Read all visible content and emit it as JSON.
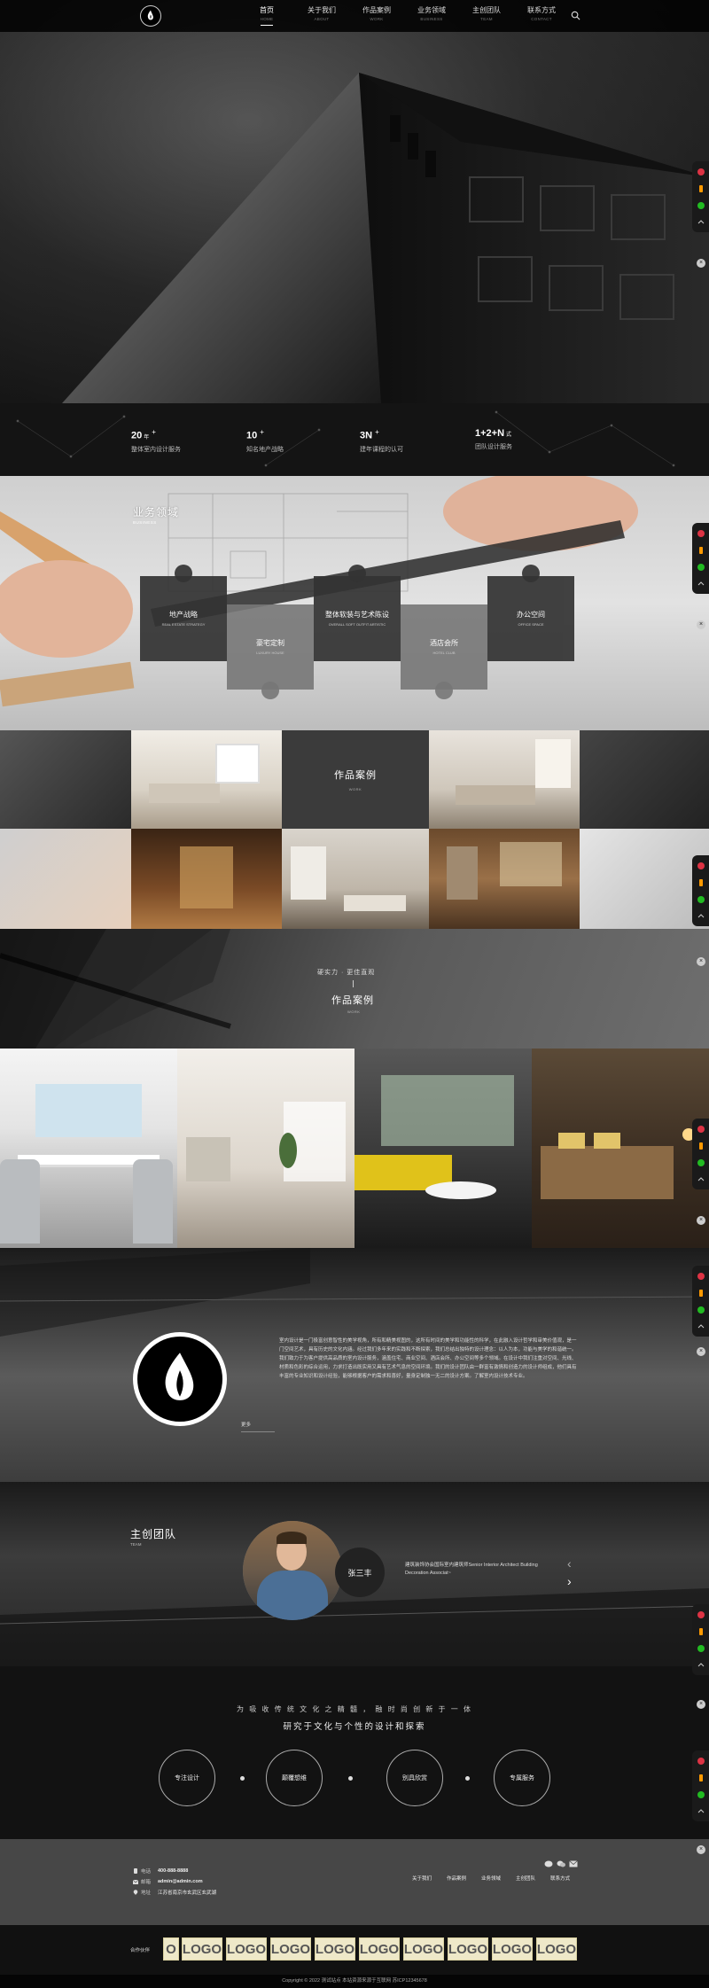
{
  "nav": [
    {
      "cn": "首页",
      "en": "HOME"
    },
    {
      "cn": "关于我们",
      "en": "ABOUT"
    },
    {
      "cn": "作品案例",
      "en": "WORK"
    },
    {
      "cn": "业务领域",
      "en": "BUSINESS"
    },
    {
      "cn": "主创团队",
      "en": "TEAM"
    },
    {
      "cn": "联系方式",
      "en": "CONTACT"
    }
  ],
  "stats": [
    {
      "num": "20",
      "unit": "年",
      "label": "整体室内设计服务"
    },
    {
      "num": "10",
      "unit": "",
      "label": "知名地产战略"
    },
    {
      "num": "3N",
      "unit": "",
      "label": "建年课程的认可"
    },
    {
      "num": "1+2+N",
      "unit": "式",
      "label": "团队设计服务"
    }
  ],
  "business": {
    "title": "业务领域",
    "subtitle": "BUSINESS",
    "items": [
      {
        "cn": "地产战略",
        "en": "REAL ESTATE STRATEGY"
      },
      {
        "cn": "豪宅定制",
        "en": "LUXURY HOUSE"
      },
      {
        "cn": "整体软装与艺术陈设",
        "en": "OVERALL SOFT OUTFIT ARTISTIC"
      },
      {
        "cn": "酒店会所",
        "en": "HOTEL CLUB"
      },
      {
        "cn": "办公空间",
        "en": "OFFICE SPACE"
      }
    ]
  },
  "works": {
    "title": "作品案例",
    "subtitle": "WORK"
  },
  "work2": {
    "slogan": "硬实力 · 更佳直观",
    "title": "作品案例",
    "subtitle": "WORK"
  },
  "about": {
    "text": "室内设计是一门极富创意智性的美学视角，所有和精美视图的，这所有时间的美学和功能性的科学，在此融入设计哲学和审美价值观，是一门空间艺术，具有历史的文化内涵。经过我们多年来的实践和不断探索，我们总结出独特的设计理念：以人为本，功能与美学的和谐统一。我们致力于为客户提供高品质的室内设计服务，涵盖住宅、商业空间、酒店会所、办公空间等多个领域。在设计中我们注重对空间、光线、材质和色彩的综合运用，力求打造出既实用又具有艺术气息的空间环境。我们的设计团队由一群富有激情和创造力的设计师组成，他们具有丰富的专业知识和设计经验，能够根据客户的需求和喜好，量身定制独一无二的设计方案。了解室内设计技术专业。",
    "more": "更多"
  },
  "team": {
    "title": "主创团队",
    "subtitle": "TEAM",
    "name": "张三丰",
    "desc": "建筑装饰协会国际室内建筑师Senior Interior Architect Building Decoration Associat~"
  },
  "culture": {
    "line1": "为 吸 收 传 统 文 化 之 精 髓 ， 融 时 尚 创 新 于 一 体",
    "line2": "研究于文化与个性的设计和探索",
    "items": [
      "专注设计",
      "颠覆想维",
      "别具欣赏",
      "专属服务"
    ]
  },
  "footer": {
    "contact": [
      {
        "key": "电话",
        "value": "400-888-8888"
      },
      {
        "key": "邮箱",
        "value": "admin@admin.com"
      },
      {
        "key": "地址",
        "value": "江苏省南京市玄武区玄武湖"
      }
    ],
    "links": [
      "关于我们",
      "作品案例",
      "业务领域",
      "主创团队",
      "联系方式"
    ]
  },
  "partners": {
    "label": "合作伙伴",
    "logos": [
      "O",
      "LOGO",
      "LOGO",
      "LOGO",
      "LOGO",
      "LOGO",
      "LOGO",
      "LOGO",
      "LOGO",
      "LOGO"
    ]
  },
  "copyright": "Copyright © 2022 测试站点 本站资源来源于互联网 苏ICP12345678"
}
